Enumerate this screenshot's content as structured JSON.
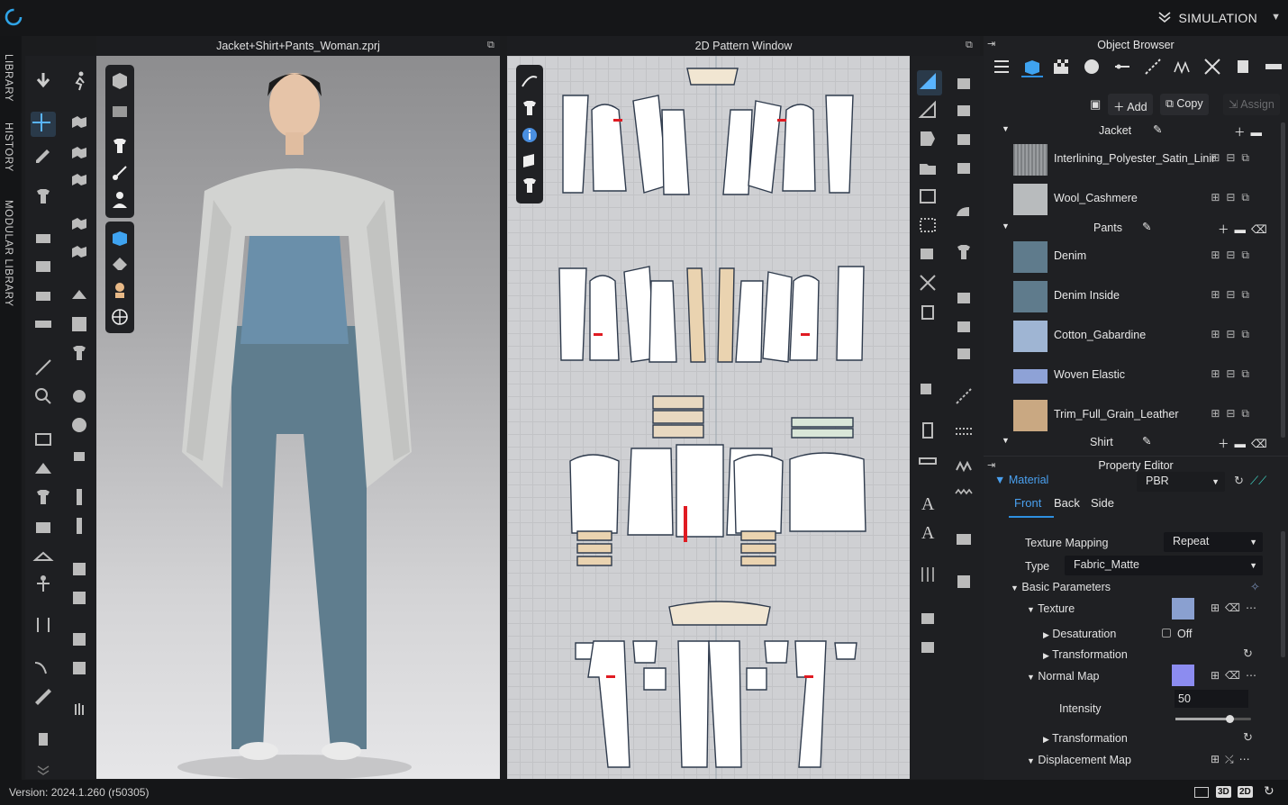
{
  "topbar": {
    "mode_label": "SIMULATION"
  },
  "side_tabs": [
    "LIBRARY",
    "HISTORY",
    "MODULAR LIBRARY"
  ],
  "viewport3d": {
    "title": "Jacket+Shirt+Pants_Woman.zprj"
  },
  "viewport2d": {
    "title": "2D Pattern Window"
  },
  "object_browser": {
    "title": "Object Browser",
    "add_label": "Add",
    "copy_label": "Copy",
    "assign_label": "Assign",
    "groups": [
      {
        "name": "Jacket",
        "materials": [
          {
            "name": "Interlining_Polyester_Satin_Linir",
            "color": "#8c8f92"
          },
          {
            "name": "Wool_Cashmere",
            "color": "#b8bbbd"
          }
        ]
      },
      {
        "name": "Pants",
        "materials": [
          {
            "name": "Denim",
            "color": "#5f7b8c"
          },
          {
            "name": "Denim Inside",
            "color": "#5f7b8c"
          },
          {
            "name": "Cotton_Gabardine",
            "color": "#9fb5d3"
          },
          {
            "name": "Woven Elastic",
            "color": "#8ea2d6"
          },
          {
            "name": "Trim_Full_Grain_Leather",
            "color": "#c9a882"
          }
        ]
      },
      {
        "name": "Shirt",
        "materials": []
      }
    ]
  },
  "property_editor": {
    "title": "Property Editor",
    "section": "Material",
    "material_type": "PBR",
    "tabs": [
      "Front",
      "Back",
      "Side"
    ],
    "texture_mapping_label": "Texture Mapping",
    "texture_mapping_value": "Repeat",
    "type_label": "Type",
    "type_value": "Fabric_Matte",
    "basic_params": "Basic Parameters",
    "texture": "Texture",
    "texture_color": "#8aa0d0",
    "desaturation": "Desaturation",
    "desaturation_value": "Off",
    "transformation": "Transformation",
    "normal_map": "Normal Map",
    "normal_map_color": "#8c8cf0",
    "intensity_label": "Intensity",
    "intensity_value": "50",
    "intensity_fraction": 0.5,
    "transformation2": "Transformation",
    "displacement_map": "Displacement Map"
  },
  "status": {
    "version": "Version: 2024.1.260 (r50305)",
    "view_buttons": [
      "3D",
      "2D"
    ]
  }
}
